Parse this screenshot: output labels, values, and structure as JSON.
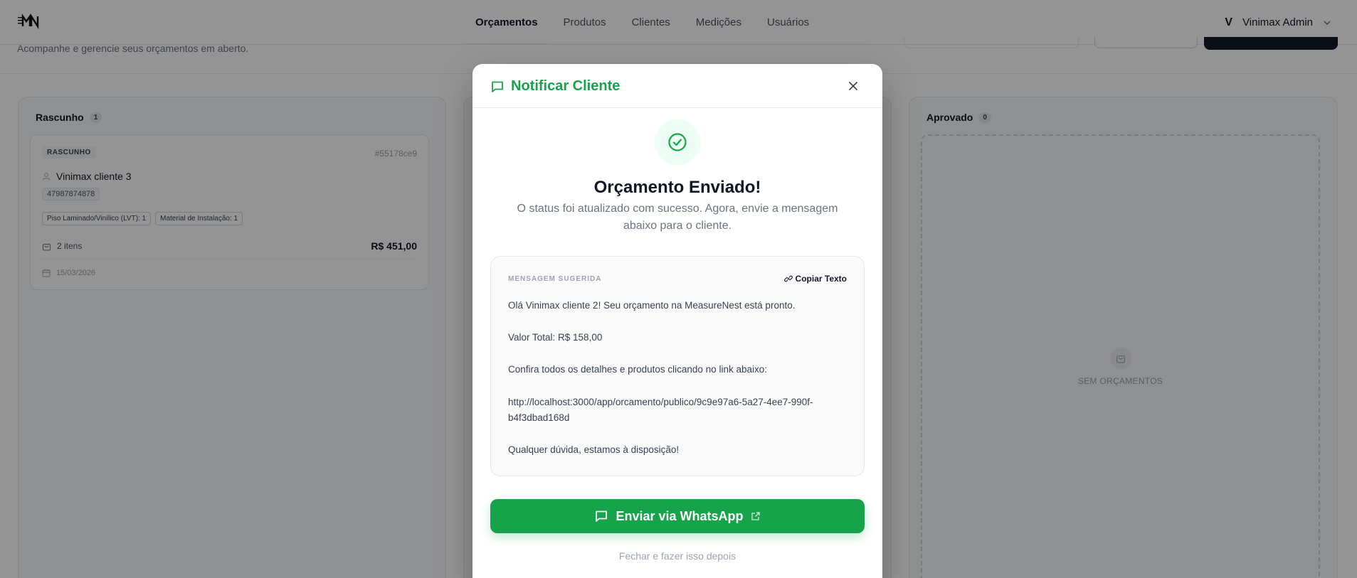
{
  "nav": {
    "items": [
      "Orçamentos",
      "Produtos",
      "Clientes",
      "Medições",
      "Usuários"
    ],
    "active_index": 0
  },
  "user": {
    "initial": "V",
    "name": "Vinimax Admin"
  },
  "page": {
    "subtitle": "Acompanhe e gerencie seus orçamentos em aberto."
  },
  "columns": [
    {
      "title": "Rascunho",
      "count": "1",
      "card": {
        "status": "RASCUNHO",
        "id": "#55178ce9",
        "client": "Vinimax cliente 3",
        "phone": "47987874878",
        "chips": [
          "Piso Laminado/Vinílico (LVT): 1",
          "Material de Instalação: 1"
        ],
        "items": "2 itens",
        "total": "R$ 451,00",
        "date": "15/03/2026"
      }
    },
    {
      "title": "Aprovado",
      "count": "0",
      "empty_text": "SEM ORÇAMENTOS"
    }
  ],
  "modal": {
    "title": "Notificar Cliente",
    "success_title": "Orçamento Enviado!",
    "success_desc": "O status foi atualizado com sucesso. Agora, envie a mensagem abaixo para o cliente.",
    "message_label": "MENSAGEM SUGERIDA",
    "copy_label": "Copiar Texto",
    "message": "Olá Vinimax cliente 2! Seu orçamento na MeasureNest está pronto.\n\nValor Total: R$ 158,00\n\nConfira todos os detalhes e produtos clicando no link abaixo:\n\nhttp://localhost:3000/app/orcamento/publico/9c9e97a6-5a27-4ee7-990f-b4f3dbad168d\n\nQualquer dúvida, estamos à disposição!",
    "whatsapp_label": "Enviar via WhatsApp",
    "later_label": "Fechar e fazer isso depois"
  },
  "colors": {
    "accent_green": "#16a34a",
    "overlay": "rgba(0,0,0,0.42)"
  }
}
